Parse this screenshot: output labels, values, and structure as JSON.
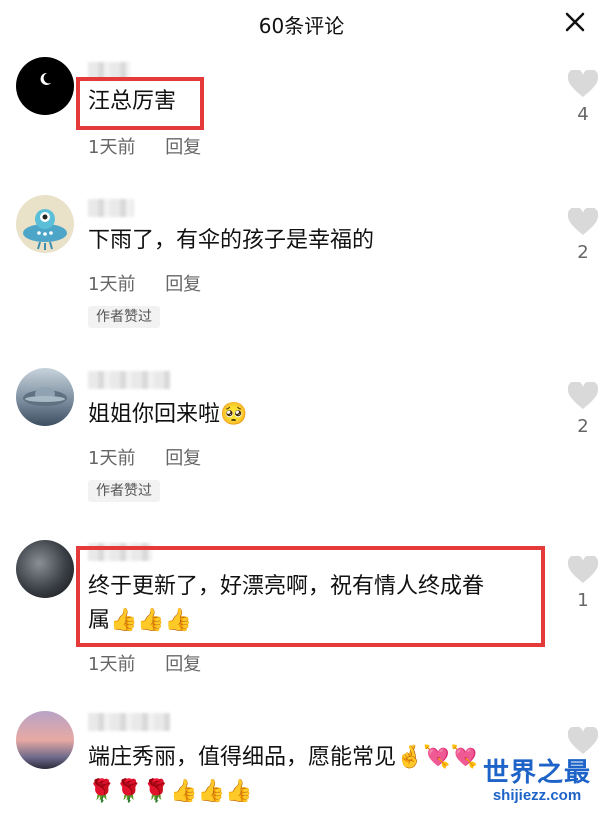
{
  "header": {
    "title": "60条评论",
    "close_icon": "close-icon"
  },
  "comments": [
    {
      "text": "汪总厉害",
      "time": "1天前",
      "reply": "回复",
      "likes": "4",
      "badge": ""
    },
    {
      "text": "下雨了，有伞的孩子是幸福的",
      "time": "1天前",
      "reply": "回复",
      "likes": "2",
      "badge": "作者赞过"
    },
    {
      "text": "姐姐你回来啦🥺",
      "time": "1天前",
      "reply": "回复",
      "likes": "2",
      "badge": "作者赞过"
    },
    {
      "text_line1": "终于更新了，好漂亮啊，祝有情人终成眷",
      "text_line2": "属👍👍👍",
      "time": "1天前",
      "reply": "回复",
      "likes": "1",
      "badge": ""
    },
    {
      "text_line1": "端庄秀丽，值得细品，愿能常见🤞💘💘",
      "text_line2": "🌹🌹🌹👍👍👍",
      "time": "",
      "reply": "",
      "likes": "",
      "badge": ""
    }
  ],
  "watermark": {
    "line1": "世界之最",
    "line2": "shijiezz.com"
  },
  "colors": {
    "highlight": "#e43a3a",
    "watermark": "#1e63c8"
  }
}
